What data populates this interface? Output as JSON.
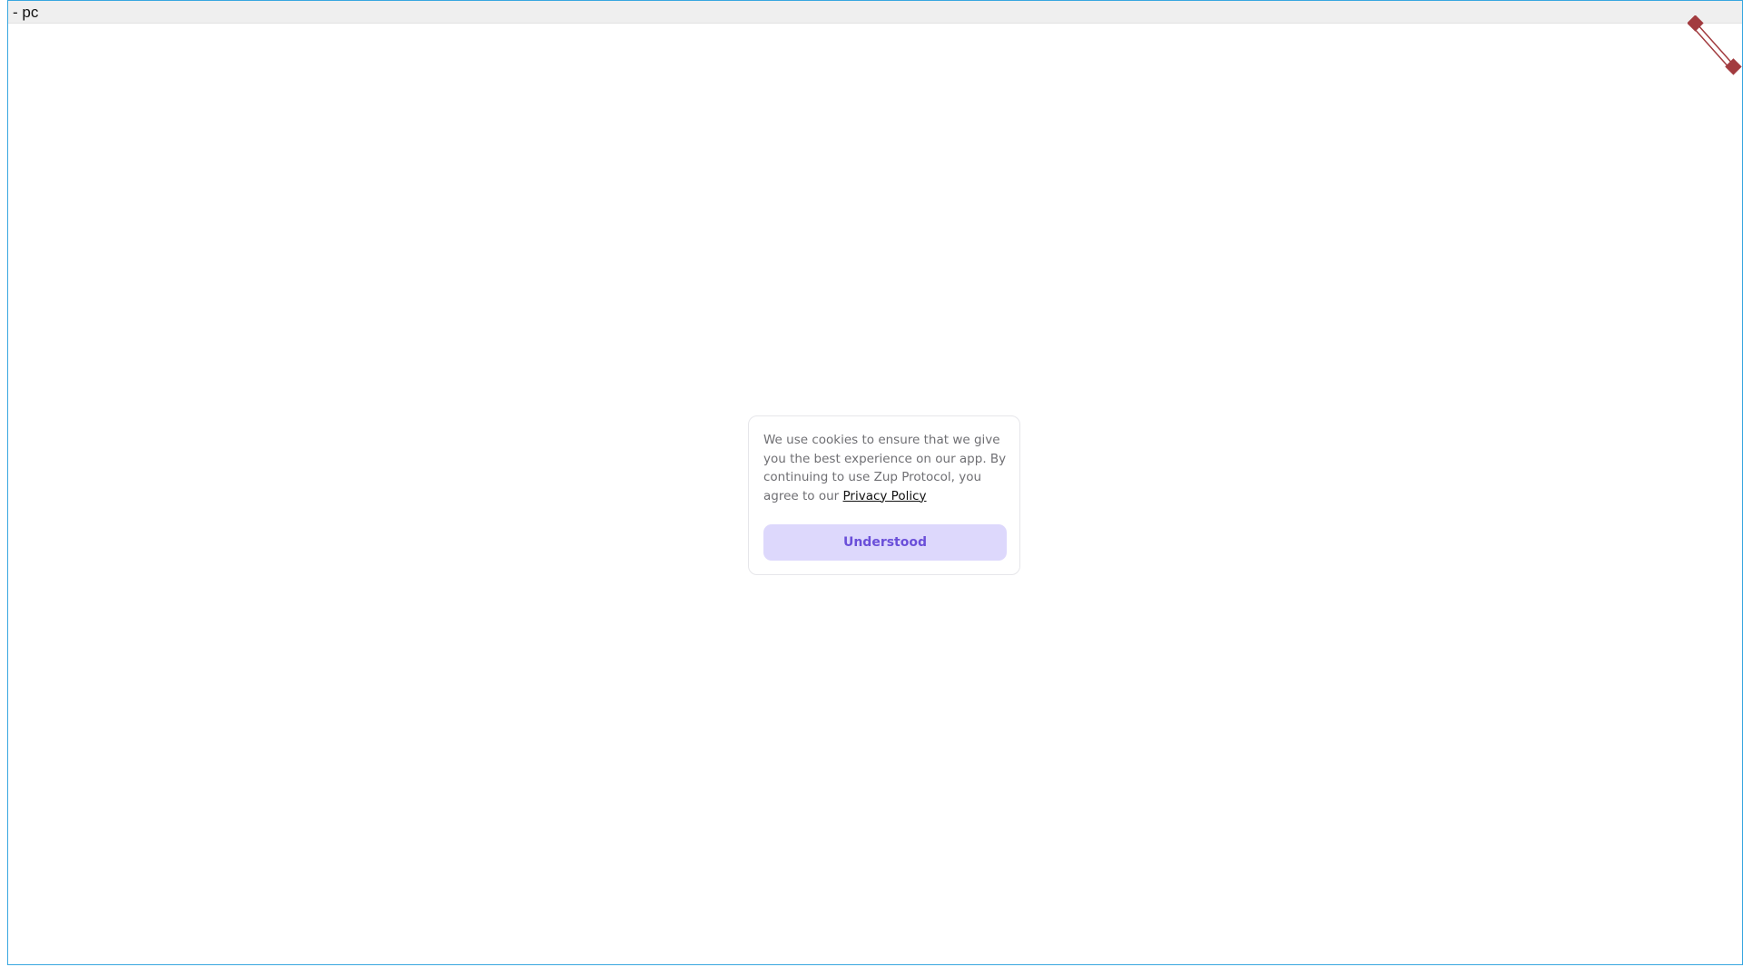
{
  "window": {
    "title": "- pc"
  },
  "cookie_dialog": {
    "message": "We use cookies to ensure that we give you the best experience on our app. By continuing to use Zup Protocol, you agree to our",
    "link_label": "Privacy Policy",
    "button_label": "Understood"
  },
  "colors": {
    "frame_border": "#39a7e0",
    "button_bg": "#ddd8fc",
    "button_text": "#6a4fd9",
    "handle": "#a23b3f"
  },
  "icons": {
    "corner": "resize-handle-icon"
  }
}
